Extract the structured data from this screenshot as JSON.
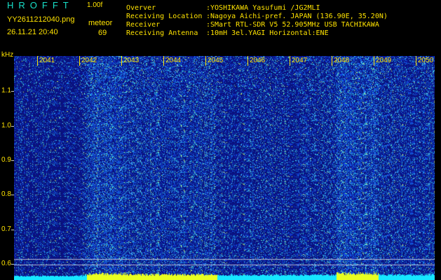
{
  "header": {
    "app_title": "HROFFT",
    "app_version": "1.00f",
    "filename": "YY2611212040.png",
    "datetime": "26.11.21 20:40",
    "meteor_label": "meteor",
    "meteor_count": "69"
  },
  "station_info": [
    {
      "key": "Overver",
      "value": ":YOSHIKAWA Yasufumi /JG2MLI"
    },
    {
      "key": "Receiving Location",
      "value": ":Nagoya Aichi-pref. JAPAN (136.90E, 35.20N)"
    },
    {
      "key": "Receiver",
      "value": ":SMart RTL-SDR V5 52.905MHz USB TACHIKAWA"
    },
    {
      "key": "Receiving Antenna",
      "value": ":10mH 3el.YAGI Horizontal:ENE"
    }
  ],
  "y_axis": {
    "unit": "kHz",
    "ticks": [
      "1.1",
      "1.0",
      "0.9",
      "0.8",
      "0.7",
      "0.6"
    ],
    "tick_values": [
      1.1,
      1.0,
      0.9,
      0.8,
      0.7,
      0.6
    ]
  },
  "x_axis": {
    "ticks": [
      "2041",
      "2042",
      "2043",
      "2044",
      "2045",
      "2046",
      "2047",
      "2048",
      "2049",
      "2050"
    ]
  },
  "colors": {
    "label": "#ffe300",
    "title": "#19e0c8",
    "background": "#000000",
    "spectrum_low": "#0a1a8c",
    "spectrum_high": "#00ffff"
  }
}
